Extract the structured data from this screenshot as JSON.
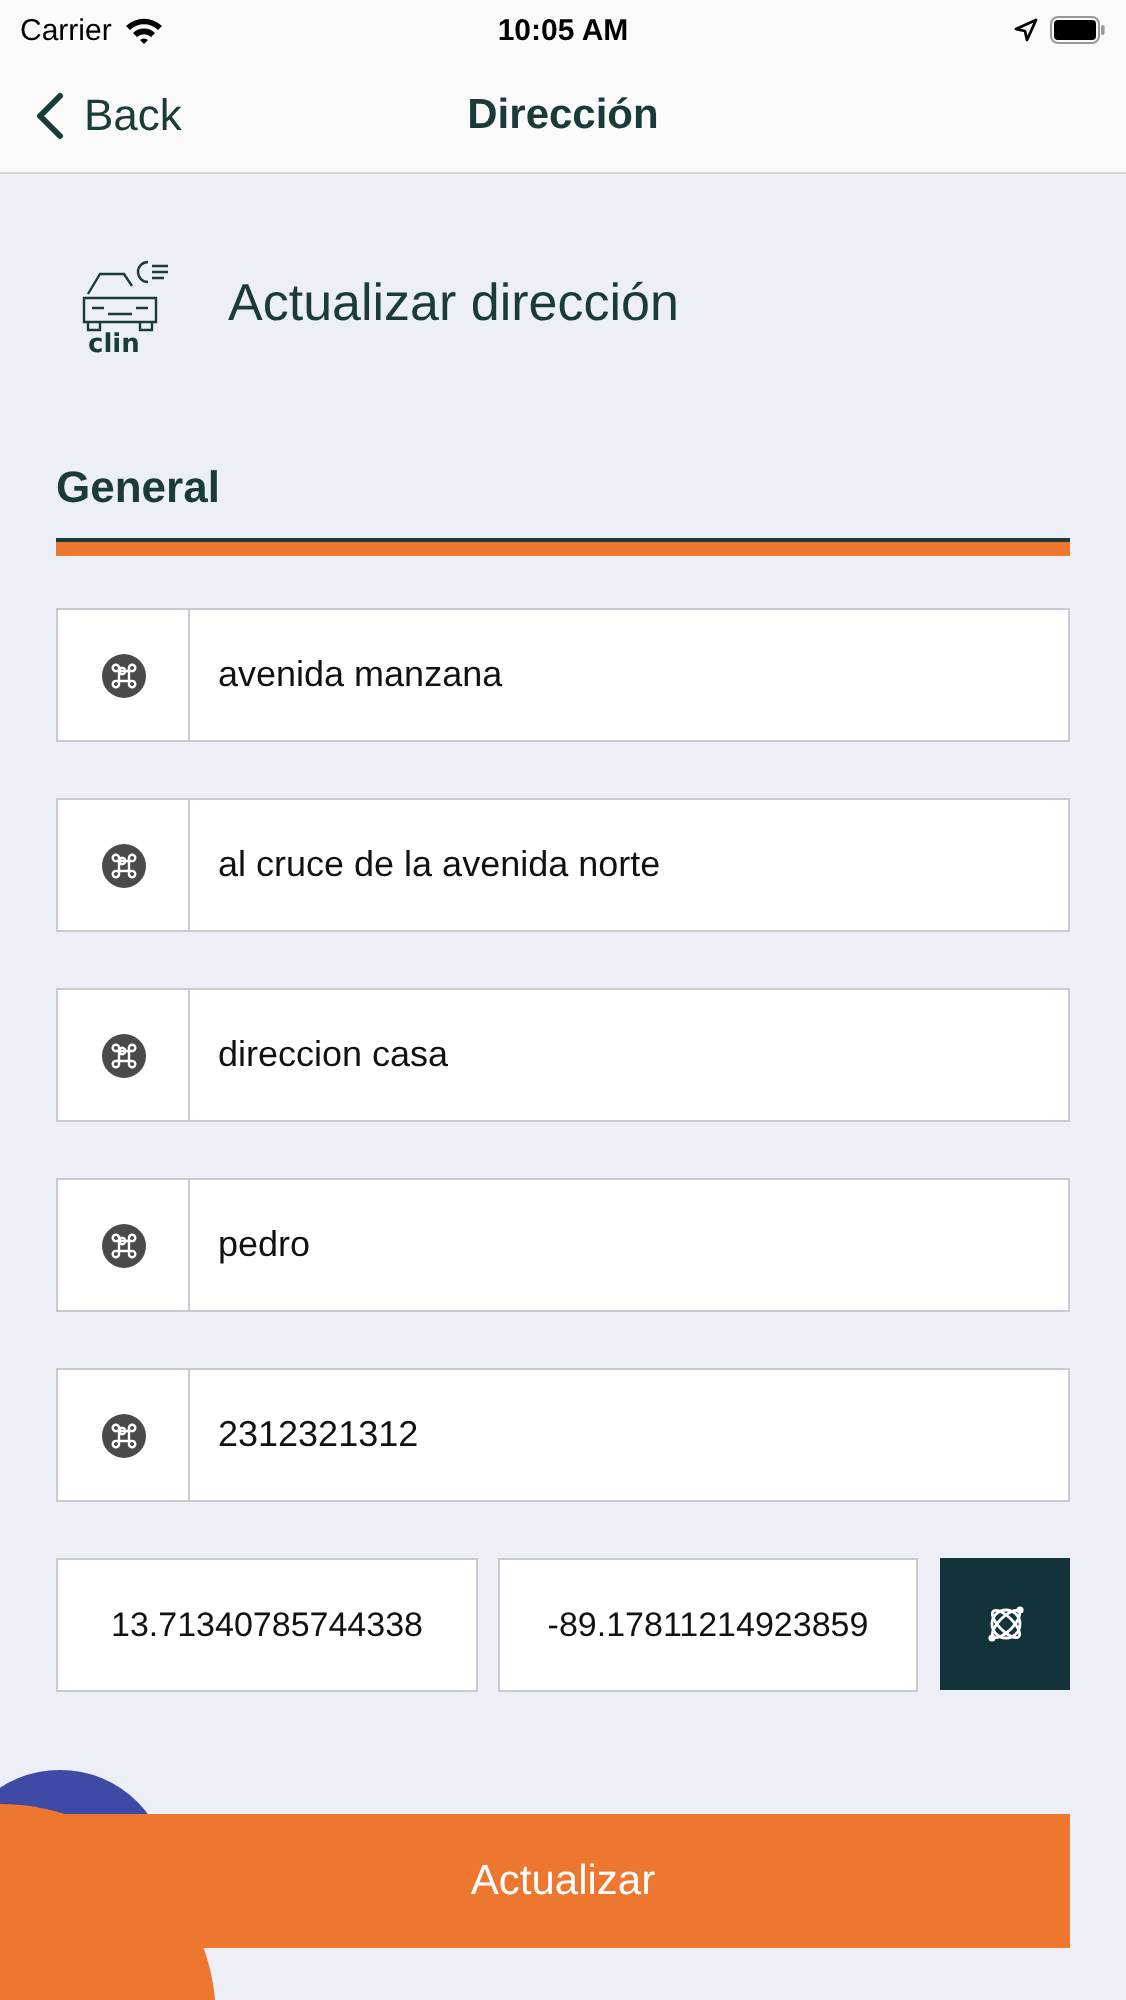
{
  "status_bar": {
    "carrier": "Carrier",
    "time": "10:05 AM"
  },
  "nav": {
    "back": "Back",
    "title": "Dirección"
  },
  "header": {
    "logo_text": "clin",
    "title": "Actualizar dirección"
  },
  "section": {
    "title": "General"
  },
  "fields": [
    {
      "value": "avenida manzana"
    },
    {
      "value": "al cruce de la avenida norte"
    },
    {
      "value": "direccion casa"
    },
    {
      "value": "pedro"
    },
    {
      "value": "2312321312"
    }
  ],
  "coordinates": {
    "latitude": "13.71340785744338",
    "longitude": "-89.17811214923859"
  },
  "submit": "Actualizar"
}
